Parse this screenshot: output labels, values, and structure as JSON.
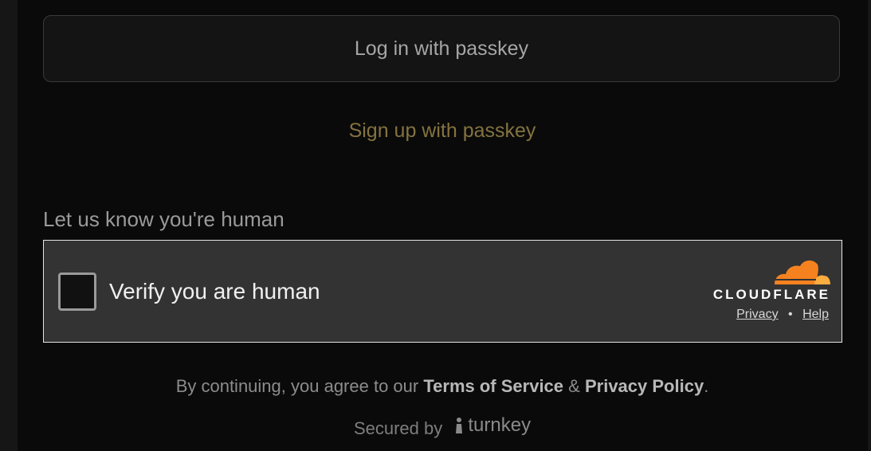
{
  "auth": {
    "login_label": "Log in with passkey",
    "signup_label": "Sign up with passkey"
  },
  "captcha": {
    "heading": "Let us know you're human",
    "verify_label": "Verify you are human",
    "brand_wordmark": "CLOUDFLARE",
    "privacy_link": "Privacy",
    "separator": "•",
    "help_link": "Help"
  },
  "legal": {
    "prefix": "By continuing, you agree to our",
    "terms_link": "Terms of Service",
    "amp": "&",
    "privacy_link": "Privacy Policy",
    "suffix": "."
  },
  "footer": {
    "secured_prefix": "Secured by",
    "brand": "turnkey"
  },
  "icons": {
    "cloud": "cloudflare-cloud-icon",
    "turnkey": "turnkey-logo-icon"
  },
  "colors": {
    "background": "#0a0a0a",
    "signup_accent": "#847340",
    "cloudflare_orange": "#f6821f",
    "cloudflare_light_orange": "#fbad41",
    "widget_bg": "#333333"
  }
}
